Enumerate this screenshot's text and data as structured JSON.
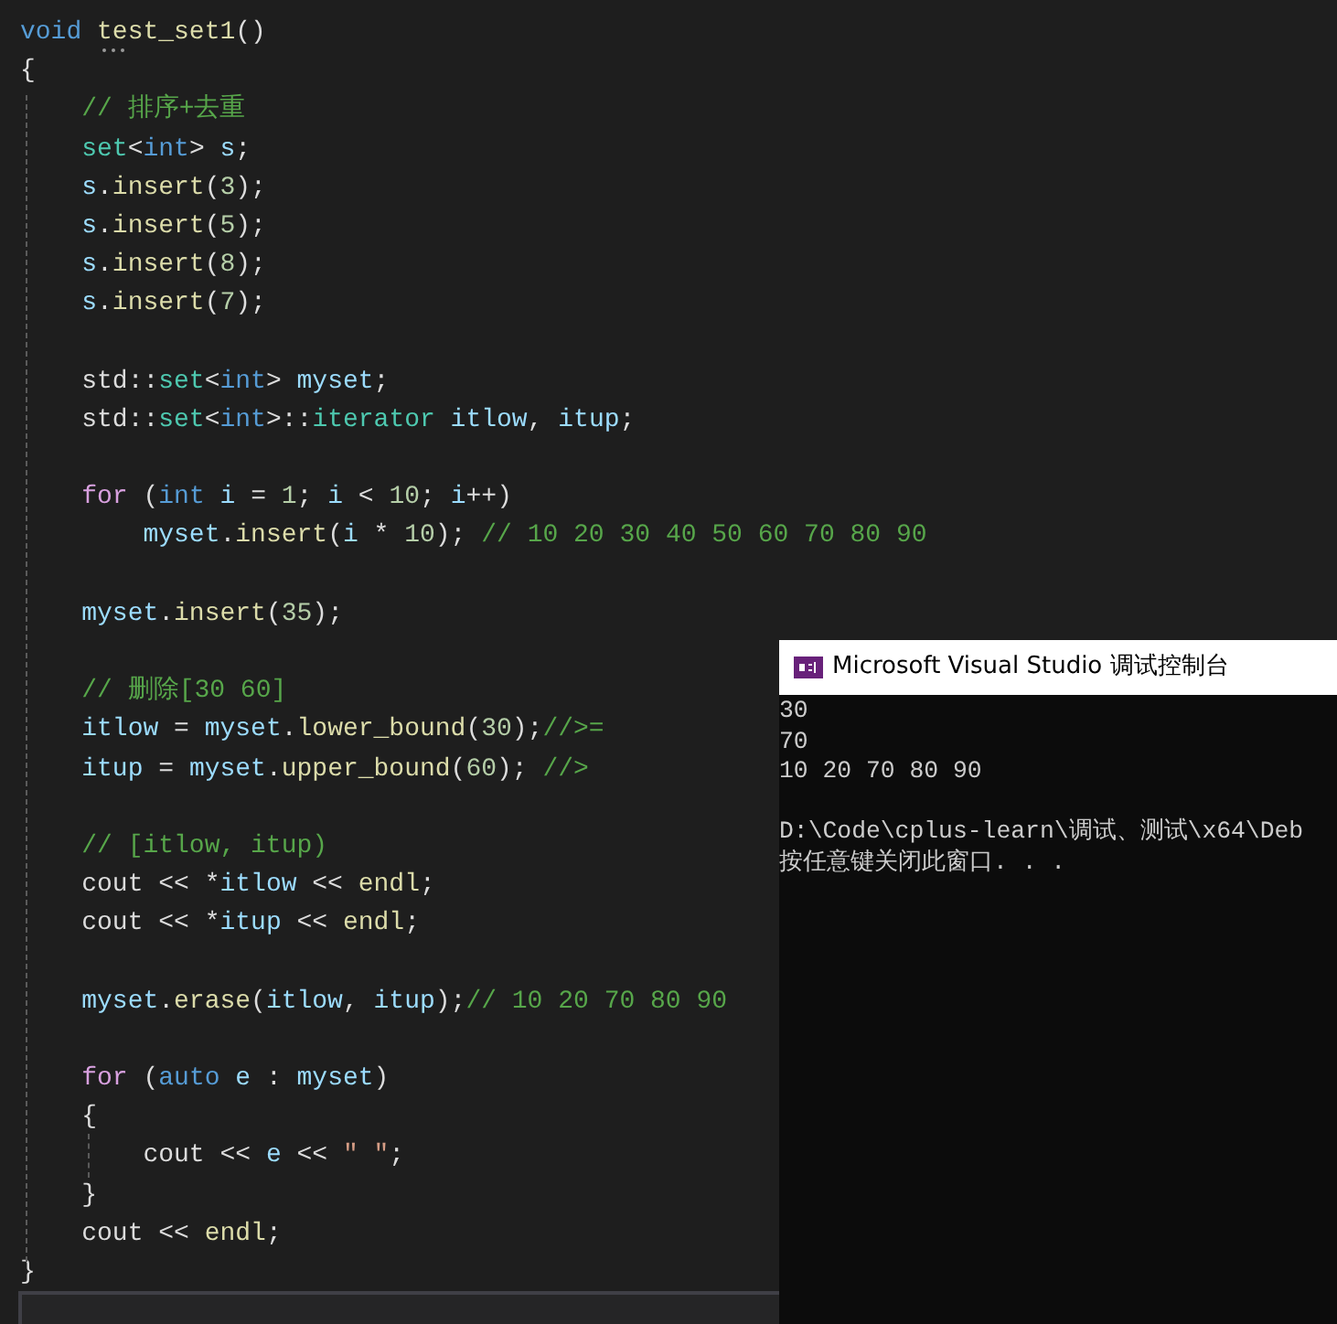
{
  "editor": {
    "lines": [
      {
        "kind": "code",
        "tokens": [
          {
            "kind": "kw",
            "text": "void"
          },
          {
            "kind": "fn",
            "text": " test_set1"
          },
          {
            "kind": "pl",
            "text": "()"
          }
        ]
      },
      {
        "kind": "code",
        "tokens": [
          {
            "kind": "pl",
            "text": "{"
          }
        ]
      },
      {
        "kind": "code",
        "tokens": [
          {
            "kind": "cmt",
            "text": "    // 排序+去重"
          }
        ]
      },
      {
        "kind": "code",
        "tokens": [
          {
            "kind": "type",
            "text": "    set"
          },
          {
            "kind": "pl",
            "text": "<"
          },
          {
            "kind": "kw",
            "text": "int"
          },
          {
            "kind": "pl",
            "text": "> "
          },
          {
            "kind": "var",
            "text": "s"
          },
          {
            "kind": "pl",
            "text": ";"
          }
        ]
      },
      {
        "kind": "code",
        "tokens": [
          {
            "kind": "var",
            "text": "    s"
          },
          {
            "kind": "pl",
            "text": "."
          },
          {
            "kind": "fn",
            "text": "insert"
          },
          {
            "kind": "pl",
            "text": "("
          },
          {
            "kind": "num",
            "text": "3"
          },
          {
            "kind": "pl",
            "text": ");"
          }
        ]
      },
      {
        "kind": "code",
        "tokens": [
          {
            "kind": "var",
            "text": "    s"
          },
          {
            "kind": "pl",
            "text": "."
          },
          {
            "kind": "fn",
            "text": "insert"
          },
          {
            "kind": "pl",
            "text": "("
          },
          {
            "kind": "num",
            "text": "5"
          },
          {
            "kind": "pl",
            "text": ");"
          }
        ]
      },
      {
        "kind": "code",
        "tokens": [
          {
            "kind": "var",
            "text": "    s"
          },
          {
            "kind": "pl",
            "text": "."
          },
          {
            "kind": "fn",
            "text": "insert"
          },
          {
            "kind": "pl",
            "text": "("
          },
          {
            "kind": "num",
            "text": "8"
          },
          {
            "kind": "pl",
            "text": ");"
          }
        ]
      },
      {
        "kind": "code",
        "tokens": [
          {
            "kind": "var",
            "text": "    s"
          },
          {
            "kind": "pl",
            "text": "."
          },
          {
            "kind": "fn",
            "text": "insert"
          },
          {
            "kind": "pl",
            "text": "("
          },
          {
            "kind": "num",
            "text": "7"
          },
          {
            "kind": "pl",
            "text": ");"
          }
        ]
      },
      {
        "kind": "blank"
      },
      {
        "kind": "code",
        "tokens": [
          {
            "kind": "pl",
            "text": "    std::"
          },
          {
            "kind": "type",
            "text": "set"
          },
          {
            "kind": "pl",
            "text": "<"
          },
          {
            "kind": "kw",
            "text": "int"
          },
          {
            "kind": "pl",
            "text": "> "
          },
          {
            "kind": "var",
            "text": "myset"
          },
          {
            "kind": "pl",
            "text": ";"
          }
        ]
      },
      {
        "kind": "code",
        "tokens": [
          {
            "kind": "pl",
            "text": "    std::"
          },
          {
            "kind": "type",
            "text": "set"
          },
          {
            "kind": "pl",
            "text": "<"
          },
          {
            "kind": "kw",
            "text": "int"
          },
          {
            "kind": "pl",
            "text": ">::"
          },
          {
            "kind": "type",
            "text": "iterator"
          },
          {
            "kind": "var",
            "text": " itlow"
          },
          {
            "kind": "pl",
            "text": ", "
          },
          {
            "kind": "var",
            "text": "itup"
          },
          {
            "kind": "pl",
            "text": ";"
          }
        ]
      },
      {
        "kind": "blank"
      },
      {
        "kind": "code",
        "tokens": [
          {
            "kind": "ctl",
            "text": "    for"
          },
          {
            "kind": "pl",
            "text": " ("
          },
          {
            "kind": "kw",
            "text": "int"
          },
          {
            "kind": "var",
            "text": " i"
          },
          {
            "kind": "pl",
            "text": " = "
          },
          {
            "kind": "num",
            "text": "1"
          },
          {
            "kind": "pl",
            "text": "; "
          },
          {
            "kind": "var",
            "text": "i"
          },
          {
            "kind": "pl",
            "text": " < "
          },
          {
            "kind": "num",
            "text": "10"
          },
          {
            "kind": "pl",
            "text": "; "
          },
          {
            "kind": "var",
            "text": "i"
          },
          {
            "kind": "pl",
            "text": "++)"
          }
        ]
      },
      {
        "kind": "code",
        "tokens": [
          {
            "kind": "var",
            "text": "        myset"
          },
          {
            "kind": "pl",
            "text": "."
          },
          {
            "kind": "fn",
            "text": "insert"
          },
          {
            "kind": "pl",
            "text": "("
          },
          {
            "kind": "var",
            "text": "i"
          },
          {
            "kind": "pl",
            "text": " * "
          },
          {
            "kind": "num",
            "text": "10"
          },
          {
            "kind": "pl",
            "text": "); "
          },
          {
            "kind": "cmt",
            "text": "// 10 20 30 40 50 60 70 80 90"
          }
        ]
      },
      {
        "kind": "blank"
      },
      {
        "kind": "code",
        "tokens": [
          {
            "kind": "var",
            "text": "    myset"
          },
          {
            "kind": "pl",
            "text": "."
          },
          {
            "kind": "fn",
            "text": "insert"
          },
          {
            "kind": "pl",
            "text": "("
          },
          {
            "kind": "num",
            "text": "35"
          },
          {
            "kind": "pl",
            "text": ");"
          }
        ]
      },
      {
        "kind": "blank"
      },
      {
        "kind": "code",
        "tokens": [
          {
            "kind": "cmt",
            "text": "    // 删除[30 60]"
          }
        ]
      },
      {
        "kind": "code",
        "tokens": [
          {
            "kind": "var",
            "text": "    itlow"
          },
          {
            "kind": "pl",
            "text": " = "
          },
          {
            "kind": "var",
            "text": "myset"
          },
          {
            "kind": "pl",
            "text": "."
          },
          {
            "kind": "fn",
            "text": "lower_bound"
          },
          {
            "kind": "pl",
            "text": "("
          },
          {
            "kind": "num",
            "text": "30"
          },
          {
            "kind": "pl",
            "text": ");"
          },
          {
            "kind": "cmt",
            "text": "//>="
          }
        ]
      },
      {
        "kind": "code",
        "tokens": [
          {
            "kind": "var",
            "text": "    itup"
          },
          {
            "kind": "pl",
            "text": " = "
          },
          {
            "kind": "var",
            "text": "myset"
          },
          {
            "kind": "pl",
            "text": "."
          },
          {
            "kind": "fn",
            "text": "upper_bound"
          },
          {
            "kind": "pl",
            "text": "("
          },
          {
            "kind": "num",
            "text": "60"
          },
          {
            "kind": "pl",
            "text": "); "
          },
          {
            "kind": "cmt",
            "text": "//>"
          }
        ]
      },
      {
        "kind": "blank"
      },
      {
        "kind": "code",
        "tokens": [
          {
            "kind": "cmt",
            "text": "    // [itlow, itup)"
          }
        ]
      },
      {
        "kind": "code",
        "tokens": [
          {
            "kind": "pl",
            "text": "    cout << *"
          },
          {
            "kind": "var",
            "text": "itlow"
          },
          {
            "kind": "pl",
            "text": " << "
          },
          {
            "kind": "fn",
            "text": "endl"
          },
          {
            "kind": "pl",
            "text": ";"
          }
        ]
      },
      {
        "kind": "code",
        "tokens": [
          {
            "kind": "pl",
            "text": "    cout << *"
          },
          {
            "kind": "var",
            "text": "itup"
          },
          {
            "kind": "pl",
            "text": " << "
          },
          {
            "kind": "fn",
            "text": "endl"
          },
          {
            "kind": "pl",
            "text": ";"
          }
        ]
      },
      {
        "kind": "blank"
      },
      {
        "kind": "code",
        "tokens": [
          {
            "kind": "var",
            "text": "    myset"
          },
          {
            "kind": "pl",
            "text": "."
          },
          {
            "kind": "fn",
            "text": "erase"
          },
          {
            "kind": "pl",
            "text": "("
          },
          {
            "kind": "var",
            "text": "itlow"
          },
          {
            "kind": "pl",
            "text": ", "
          },
          {
            "kind": "var",
            "text": "itup"
          },
          {
            "kind": "pl",
            "text": ");"
          },
          {
            "kind": "cmt",
            "text": "// 10 20 70 80 90"
          }
        ]
      },
      {
        "kind": "blank"
      },
      {
        "kind": "code",
        "tokens": [
          {
            "kind": "ctl",
            "text": "    for"
          },
          {
            "kind": "pl",
            "text": " ("
          },
          {
            "kind": "kw",
            "text": "auto"
          },
          {
            "kind": "var",
            "text": " e"
          },
          {
            "kind": "pl",
            "text": " : "
          },
          {
            "kind": "var",
            "text": "myset"
          },
          {
            "kind": "pl",
            "text": ")"
          }
        ]
      },
      {
        "kind": "code",
        "tokens": [
          {
            "kind": "pl",
            "text": "    {"
          }
        ]
      },
      {
        "kind": "code",
        "tokens": [
          {
            "kind": "pl",
            "text": "        cout << "
          },
          {
            "kind": "var",
            "text": "e"
          },
          {
            "kind": "pl",
            "text": " << "
          },
          {
            "kind": "str",
            "text": "\" \""
          },
          {
            "kind": "pl",
            "text": ";"
          }
        ]
      },
      {
        "kind": "code",
        "tokens": [
          {
            "kind": "pl",
            "text": "    }"
          }
        ]
      },
      {
        "kind": "code",
        "tokens": [
          {
            "kind": "pl",
            "text": "    cout << "
          },
          {
            "kind": "fn",
            "text": "endl"
          },
          {
            "kind": "pl",
            "text": ";"
          }
        ]
      },
      {
        "kind": "code",
        "tokens": [
          {
            "kind": "pl",
            "text": "}"
          }
        ]
      }
    ]
  },
  "console": {
    "title": "Microsoft Visual Studio 调试控制台",
    "lines": [
      {
        "kind": "text",
        "text": "30"
      },
      {
        "kind": "text",
        "text": "70"
      },
      {
        "kind": "text",
        "text": "10 20 70 80 90"
      },
      {
        "kind": "blank"
      },
      {
        "kind": "text",
        "text": "D:\\Code\\cplus-learn\\调试、测试\\x64\\Deb"
      },
      {
        "kind": "text",
        "text": "按任意键关闭此窗口. . ."
      }
    ]
  }
}
